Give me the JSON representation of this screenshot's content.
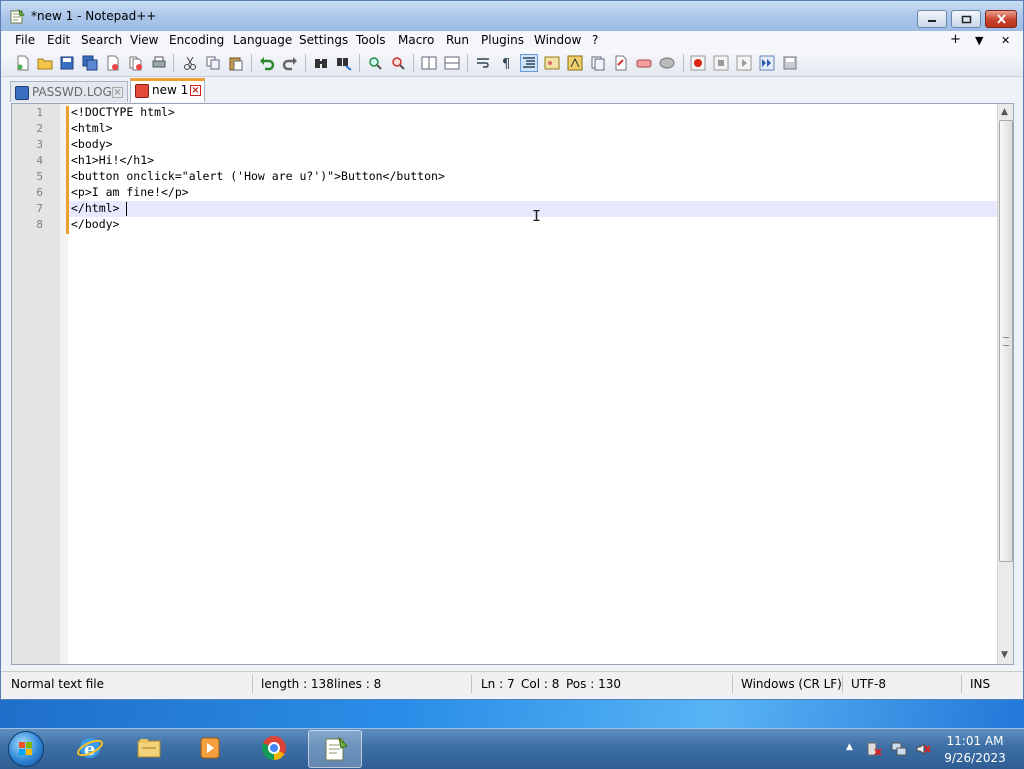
{
  "window": {
    "title": "*new 1 - Notepad++"
  },
  "menu": {
    "items": [
      "File",
      "Edit",
      "Search",
      "View",
      "Encoding",
      "Language",
      "Settings",
      "Tools",
      "Macro",
      "Run",
      "Plugins",
      "Window",
      "?"
    ],
    "right": [
      "+",
      "▼",
      "✕"
    ]
  },
  "toolbar": {
    "icons": [
      "new-file-icon",
      "open-file-icon",
      "save-icon",
      "save-all-icon",
      "close-icon",
      "close-all-icon",
      "print-icon",
      "cut-icon",
      "copy-icon",
      "paste-icon",
      "undo-icon",
      "redo-icon",
      "find-icon",
      "replace-icon",
      "zoom-in-icon",
      "zoom-out-icon",
      "sync-vertical-icon",
      "sync-horizontal-icon",
      "word-wrap-icon",
      "show-all-chars-icon",
      "indent-guide-icon",
      "udl-icon",
      "doc-map-icon",
      "function-list-icon",
      "folder-as-workspace-icon",
      "monitoring-icon",
      "record-macro-icon",
      "stop-record-icon",
      "play-macro-icon",
      "run-macro-multiple-icon",
      "save-macro-icon"
    ]
  },
  "tabs": [
    {
      "label": "PASSWD.LOG",
      "active": false
    },
    {
      "label": "new 1",
      "active": true
    }
  ],
  "editor": {
    "lines": [
      {
        "no": "1",
        "text": "<!DOCTYPE html>"
      },
      {
        "no": "2",
        "text": "<html>"
      },
      {
        "no": "3",
        "text": "<body>"
      },
      {
        "no": "4",
        "text": "<h1>Hi!</h1>"
      },
      {
        "no": "5",
        "text": "<button onclick=\"alert ('How are u?')\">Button</button>"
      },
      {
        "no": "6",
        "text": "<p>I am fine!</p>"
      },
      {
        "no": "7",
        "text": "</html>"
      },
      {
        "no": "8",
        "text": "</body>"
      }
    ],
    "current_line": 7
  },
  "status": {
    "file_type": "Normal text file",
    "length": "length : 138",
    "lines": "lines : 8",
    "ln": "Ln : 7",
    "col": "Col : 8",
    "pos": "Pos : 130",
    "eol": "Windows (CR LF)",
    "encoding": "UTF-8",
    "mode": "INS"
  },
  "taskbar": {
    "apps": [
      "internet-explorer-icon",
      "file-explorer-icon",
      "media-player-icon",
      "chrome-icon",
      "notepadpp-icon"
    ],
    "clock_time": "11:01 AM",
    "clock_date": "9/26/2023"
  },
  "colors": {
    "accent": "#f0a030",
    "current_line": "#e8e8ff"
  }
}
